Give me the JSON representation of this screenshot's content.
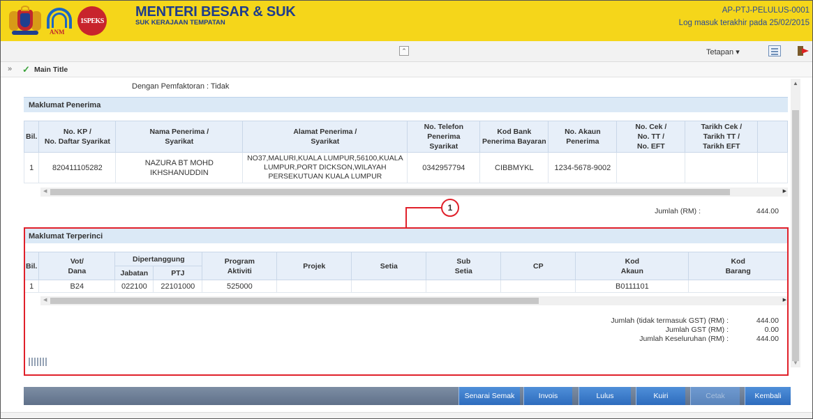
{
  "header": {
    "logo_anm": "ANM",
    "logo_1speks": "1SPEKS",
    "title": "MENTERI BESAR & SUK",
    "subtitle": "SUK KERAJAAN TEMPATAN",
    "user_code": "AP-PTJ-PELULUS-0001",
    "last_login": "Log masuk terakhir pada 25/02/2015"
  },
  "toolbar": {
    "settings_label": "Tetapan",
    "collapse_glyph": "≈"
  },
  "breadcrumb": {
    "expand_glyph": "»",
    "title": "Main Title"
  },
  "factoring": "Dengan Pemfaktoran : Tidak",
  "recipient": {
    "section_title": "Maklumat Penerima",
    "headers": [
      "Bil.",
      "No. KP /\nNo. Daftar Syarikat",
      "Nama Penerima /\nSyarikat",
      "Alamat Penerima /\nSyarikat",
      "No. Telefon Penerima\nSyarikat",
      "Kod Bank\nPenerima Bayaran",
      "No. Akaun\nPenerima",
      "No. Cek /\nNo. TT /\nNo. EFT",
      "Tarikh Cek /\nTarikh TT /\nTarikh EFT"
    ],
    "row": {
      "bil": "1",
      "no_kp": "820411105282",
      "nama": "NAZURA BT MOHD IKHSHANUDDIN",
      "alamat": "NO37,MALURI,KUALA LUMPUR,56100,KUALA LUMPUR,PORT DICKSON,WILAYAH PERSEKUTUAN KUALA LUMPUR",
      "telefon": "0342957794",
      "kod_bank": "CIBBMYKL",
      "no_akaun": "1234-5678-9002",
      "no_cek": "",
      "tarikh_cek": ""
    },
    "total_label": "Jumlah (RM) :",
    "total_value": "444.00"
  },
  "detail": {
    "section_title": "Maklumat Terperinci",
    "headers": {
      "bil": "Bil.",
      "vot": "Vot/\nDana",
      "dipertanggung": "Dipertanggung",
      "jabatan": "Jabatan",
      "ptj": "PTJ",
      "program": "Program\nAktiviti",
      "projek": "Projek",
      "setia": "Setia",
      "sub_setia": "Sub\nSetia",
      "cp": "CP",
      "kod_akaun": "Kod\nAkaun",
      "kod_barang": "Kod\nBarang"
    },
    "row": {
      "bil": "1",
      "vot": "B24",
      "jabatan": "022100",
      "ptj": "22101000",
      "program": "525000",
      "projek": "",
      "setia": "",
      "sub_setia": "",
      "cp": "",
      "kod_akaun": "B0111101",
      "kod_barang": ""
    },
    "summary": [
      {
        "label": "Jumlah (tidak termasuk GST) (RM) :",
        "value": "444.00"
      },
      {
        "label": "Jumlah GST (RM) :",
        "value": "0.00"
      },
      {
        "label": "Jumlah Keseluruhan (RM) :",
        "value": "444.00"
      }
    ]
  },
  "callout": {
    "number": "1",
    "color": "#e0202a"
  },
  "actions": {
    "senarai_semak": "Senarai Semak",
    "invois": "Invois",
    "lulus": "Lulus",
    "kuiri": "Kuiri",
    "cetak": "Cetak",
    "kembali": "Kembali"
  },
  "colors": {
    "header_bg": "#f5d61a",
    "brand_text": "#1e3c8c",
    "button_blue": "#2e6cbd"
  }
}
